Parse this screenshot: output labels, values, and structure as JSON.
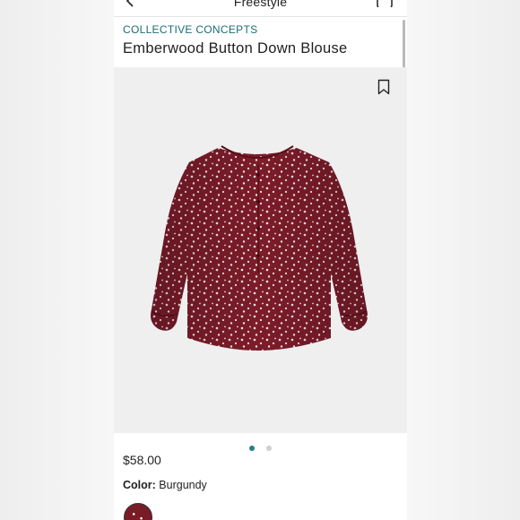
{
  "header": {
    "title": "Freestyle",
    "back_icon": "chevron-left-icon",
    "bag_icon": "shopping-bag-icon"
  },
  "product": {
    "brand": "COLLECTIVE CONCEPTS",
    "name": "Emberwood Button Down Blouse",
    "price": "$58.00",
    "color_label": "Color:",
    "color_value": "Burgundy",
    "image_description_icon": "blouse-image",
    "bookmark_icon": "bookmark-icon"
  },
  "carousel": {
    "page_count": 2,
    "active_index": 0
  },
  "colors": {
    "brand_teal": "#1a6e73",
    "active_dot": "#2b7d85",
    "burgundy": "#7a1b28"
  }
}
